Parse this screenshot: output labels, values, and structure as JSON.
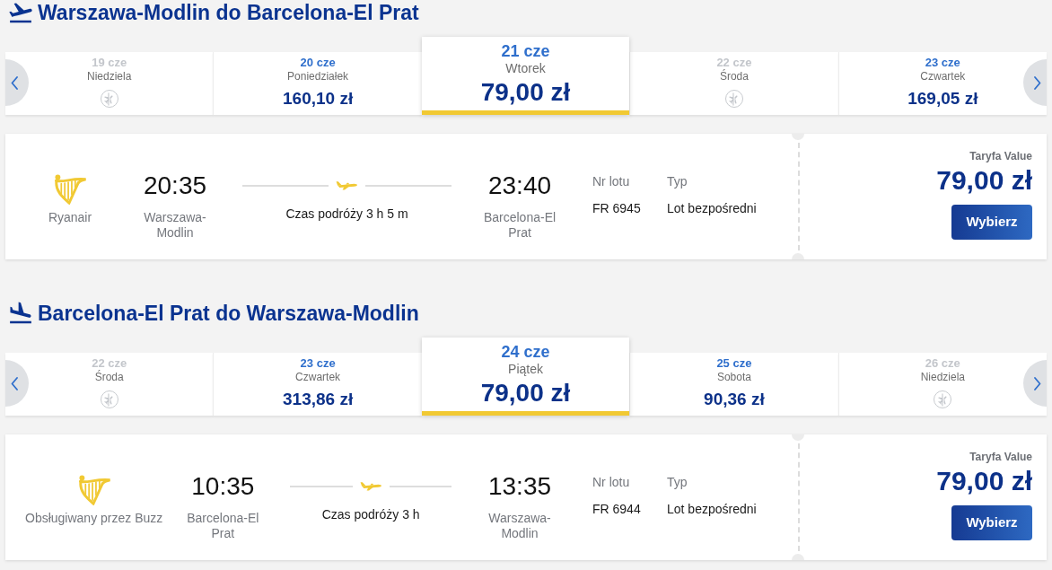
{
  "sections": [
    {
      "kind": "outbound",
      "title": "Warszawa-Modlin do Barcelona-El Prat",
      "dates": [
        {
          "date": "19 cze",
          "day": "Niedziela",
          "available": false,
          "selected": false
        },
        {
          "date": "20 cze",
          "day": "Poniedziałek",
          "price": "160,10 zł",
          "available": true,
          "selected": false
        },
        {
          "date": "21 cze",
          "day": "Wtorek",
          "price": "79,00 zł",
          "available": true,
          "selected": true
        },
        {
          "date": "22 cze",
          "day": "Środa",
          "available": false,
          "selected": false
        },
        {
          "date": "23 cze",
          "day": "Czwartek",
          "price": "169,05 zł",
          "available": true,
          "selected": false
        }
      ],
      "flight": {
        "airline": "Ryanair",
        "departure_time": "20:35",
        "departure_airport": "Warszawa-Modlin",
        "duration": "Czas podróży 3 h 5 m",
        "arrival_time": "23:40",
        "arrival_airport": "Barcelona-El Prat",
        "flight_number_label": "Nr lotu",
        "flight_number": "FR 6945",
        "type_label": "Typ",
        "type": "Lot bezpośredni",
        "fare_label": "Taryfa Value",
        "fare_price": "79,00 zł",
        "button": "Wybierz"
      }
    },
    {
      "kind": "return",
      "title": "Barcelona-El Prat do Warszawa-Modlin",
      "dates": [
        {
          "date": "22 cze",
          "day": "Środa",
          "available": false,
          "selected": false
        },
        {
          "date": "23 cze",
          "day": "Czwartek",
          "price": "313,86 zł",
          "available": true,
          "selected": false
        },
        {
          "date": "24 cze",
          "day": "Piątek",
          "price": "79,00 zł",
          "available": true,
          "selected": true
        },
        {
          "date": "25 cze",
          "day": "Sobota",
          "price": "90,36 zł",
          "available": true,
          "selected": false
        },
        {
          "date": "26 cze",
          "day": "Niedziela",
          "available": false,
          "selected": false
        }
      ],
      "flight": {
        "airline": "Obsługiwany przez Buzz",
        "departure_time": "10:35",
        "departure_airport": "Barcelona-El Prat",
        "duration": "Czas podróży 3 h",
        "arrival_time": "13:35",
        "arrival_airport": "Warszawa-Modlin",
        "flight_number_label": "Nr lotu",
        "flight_number": "FR 6944",
        "type_label": "Typ",
        "type": "Lot bezpośredni",
        "fare_label": "Taryfa Value",
        "fare_price": "79,00 zł",
        "button": "Wybierz"
      }
    }
  ]
}
